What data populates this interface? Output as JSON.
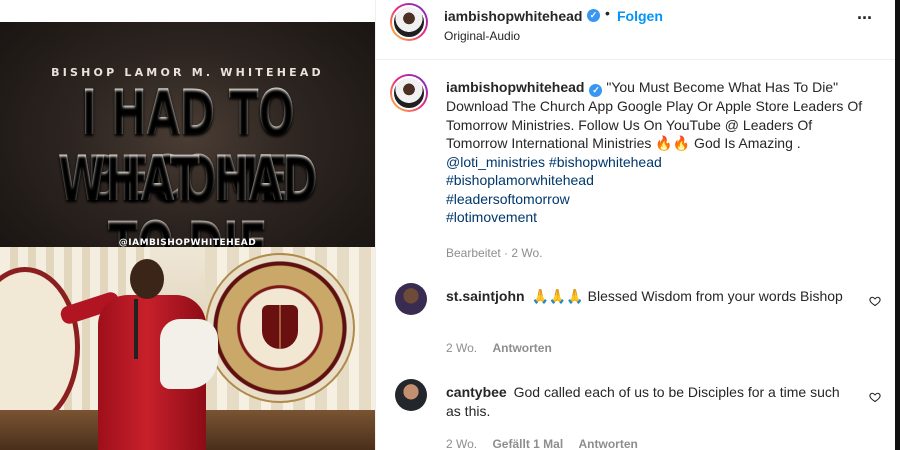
{
  "media": {
    "kicker": "BISHOP LAMOR M. WHITEHEAD",
    "headline_line1": "I HAD TO BECOME",
    "headline_line2": "WHAT HAD TO DIE",
    "handle": "@IAMBISHOPWHITEHEAD"
  },
  "header": {
    "username": "iambishopwhitehead",
    "verified_icon": "verified-badge-icon",
    "separator": "•",
    "follow_label": "Folgen",
    "subtitle": "Original-Audio",
    "more_icon": "more-options-icon"
  },
  "caption": {
    "username": "iambishopwhitehead",
    "text": "\"You Must Become What Has To Die\" Download The Church App Google Play Or Apple Store Leaders Of Tomorrow Ministries. Follow Us On YouTube @ Leaders Of Tomorrow International Ministries 🔥🔥 God Is Amazing .",
    "tags": [
      "@loti_ministries",
      "#bishopwhitehead",
      "#bishoplamorwhitehead",
      "#leadersoftomorrow",
      "#lotimovement"
    ],
    "meta": "Bearbeitet · 2 Wo."
  },
  "comments": [
    {
      "username": "st.saintjohn",
      "text": "🙏🙏🙏 Blessed Wisdom from your words Bishop",
      "time": "2 Wo.",
      "likes": "",
      "reply": "Antworten"
    },
    {
      "username": "cantybee",
      "text": "God called each of us to be Disciples for a time such as this.",
      "time": "2 Wo.",
      "likes": "Gefällt 1 Mal",
      "reply": "Antworten"
    }
  ],
  "colors": {
    "link": "#00376b",
    "follow": "#0095f6",
    "verified": "#3897f0",
    "muted": "#8e8e8e"
  }
}
